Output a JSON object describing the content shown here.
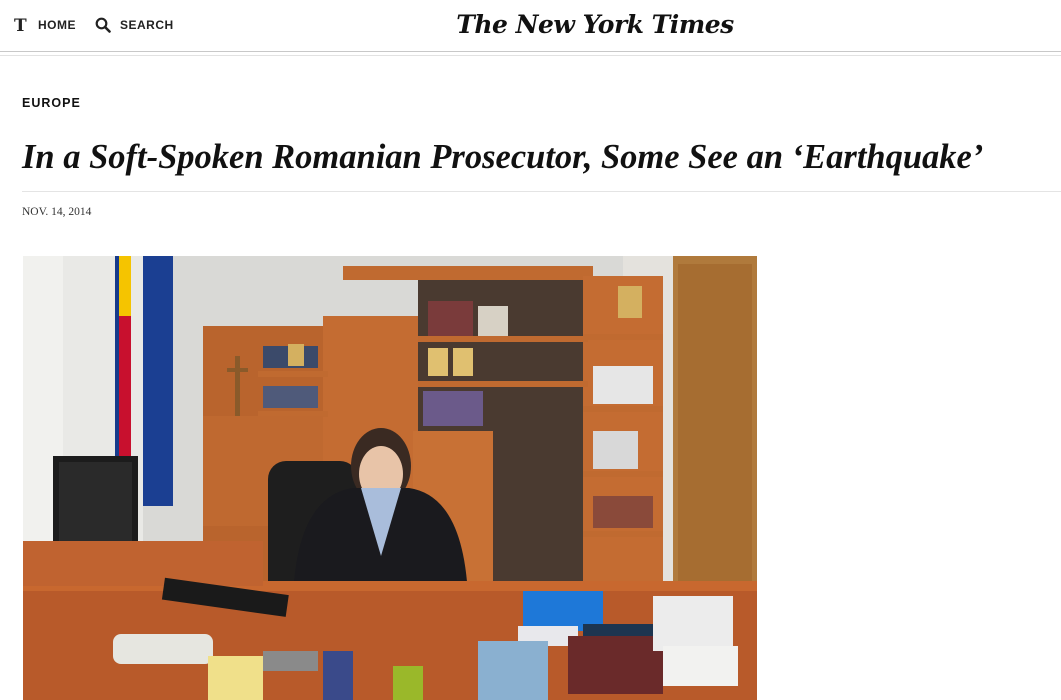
{
  "header": {
    "home_label": "HOME",
    "search_label": "SEARCH",
    "logo_text": "The New York Times",
    "home_icon": "nyt-t-icon",
    "search_icon": "search-icon"
  },
  "article": {
    "section": "EUROPE",
    "headline": "In a Soft-Spoken Romanian Prosecutor, Some See an ‘Earthquake’",
    "date": "NOV. 14, 2014"
  },
  "colors": {
    "text": "#111111",
    "rule": "#c8c8c8",
    "flag_red": "#c8102e",
    "flag_yellow": "#f5c400",
    "eu_blue": "#173b8c",
    "desk_wood": "#b85a2a"
  }
}
